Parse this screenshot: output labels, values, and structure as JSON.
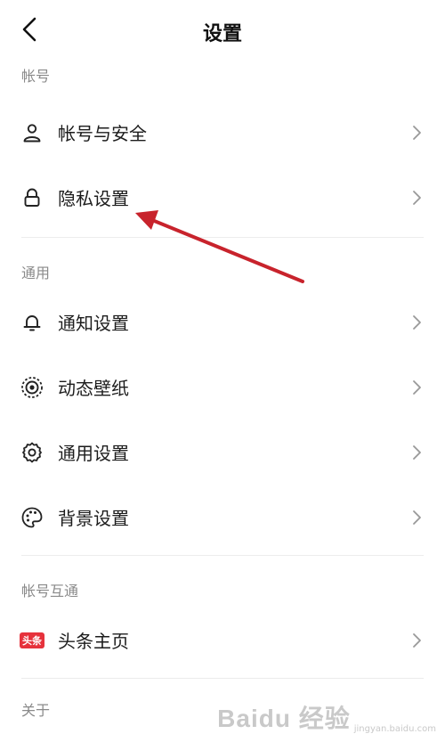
{
  "header": {
    "title": "设置",
    "back_icon": "chevron-left-icon"
  },
  "sections": [
    {
      "label": "帐号",
      "items": [
        {
          "label": "帐号与安全",
          "icon": "user-icon"
        },
        {
          "label": "隐私设置",
          "icon": "lock-icon"
        }
      ]
    },
    {
      "label": "通用",
      "items": [
        {
          "label": "通知设置",
          "icon": "bell-icon"
        },
        {
          "label": "动态壁纸",
          "icon": "dynamic-wallpaper-icon"
        },
        {
          "label": "通用设置",
          "icon": "gear-icon"
        },
        {
          "label": "背景设置",
          "icon": "palette-icon"
        }
      ]
    },
    {
      "label": "帐号互通",
      "items": [
        {
          "label": "头条主页",
          "icon": "toutiao-badge-icon",
          "badge_text": "头条"
        }
      ]
    },
    {
      "label": "关于",
      "items": []
    }
  ],
  "annotation": {
    "arrow_color": "#c8232c",
    "target": "隐私设置"
  },
  "watermark": {
    "brand": "Baidu 经验",
    "url": "jingyan.baidu.com"
  }
}
